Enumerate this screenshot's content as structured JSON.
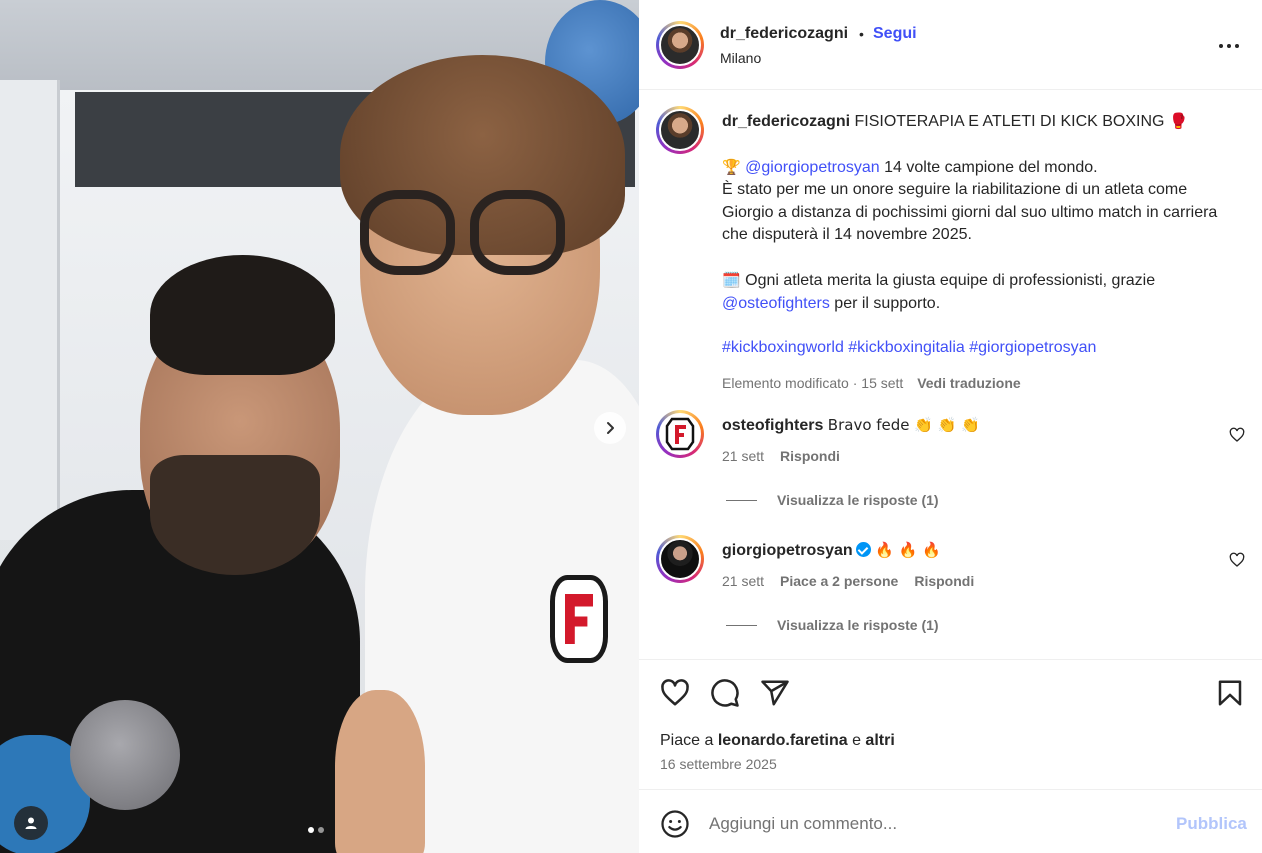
{
  "post": {
    "username": "dr_federicozagni",
    "follow_label": "Segui",
    "location": "Milano",
    "caption": {
      "title": "FISIOTERAPIA E ATLETI DI KICK BOXING",
      "title_emoji": "🥊",
      "trophy_emoji": "🏆",
      "mention1": "@giorgiopetrosyan",
      "line1_rest": " 14 volte campione del mondo.",
      "line2": "È stato per me un onore seguire la riabilitazione di un atleta come Giorgio a distanza di pochissimi giorni dal suo ultimo match in carriera che disputerà il 14 novembre 2025.",
      "calendar_emoji": "🗓️",
      "line3": " Ogni atleta merita la giusta equipe di professionisti, grazie",
      "mention2": "@osteofighters",
      "line3_rest": " per il supporto.",
      "hashtags": "#kickboxingworld #kickboxingitalia #giorgiopetrosyan",
      "edited": "Elemento modificato · 15 sett",
      "translate": "Vedi traduzione"
    },
    "comments": [
      {
        "user": "osteofighters",
        "text": "Bravo fede 👏 👏 👏",
        "time": "21 sett",
        "likes_label": "",
        "reply": "Rispondi",
        "view_replies": "Visualizza le risposte (1)"
      },
      {
        "user": "giorgiopetrosyan",
        "text": "🔥 🔥 🔥",
        "time": "21 sett",
        "likes_label": "Piace a 2 persone",
        "reply": "Rispondi",
        "view_replies": "Visualizza le risposte (1)"
      }
    ],
    "likes_prefix": "Piace a ",
    "likes_user": "leonardo.faretina",
    "likes_mid": " e ",
    "likes_suffix": "altri",
    "date": "16 settembre 2025",
    "comment_placeholder": "Aggiungi un commento...",
    "publish_label": "Pubblica"
  },
  "carousel": {
    "slides": 2,
    "current": 1
  },
  "colors": {
    "accent": "#4150f7",
    "publish_disabled": "#b2c5fb",
    "verified": "#0095f6"
  }
}
